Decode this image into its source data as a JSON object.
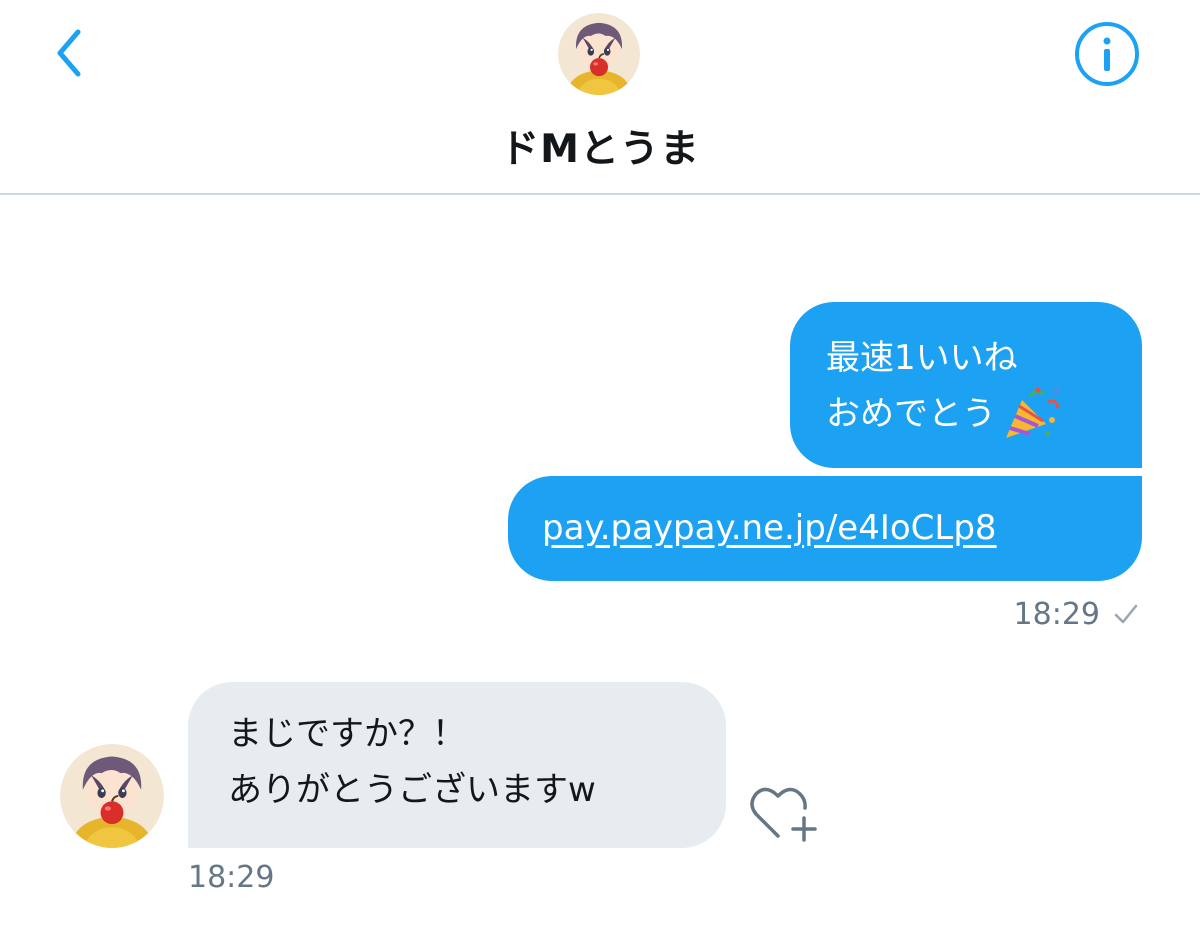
{
  "header": {
    "contact_name": "ドMとうま",
    "back_icon": "chevron-left-icon",
    "info_icon": "info-icon",
    "accent_color": "#1da1f2"
  },
  "messages": {
    "sent": [
      {
        "lines": [
          "最速1いいね",
          "おめでとう"
        ],
        "emoji": "party-popper-icon"
      },
      {
        "link_text": "pay.paypay.ne.jp/e4IoCLp8"
      }
    ],
    "sent_time": "18:29",
    "sent_status_icon": "check-icon",
    "received": {
      "lines": [
        "まじですか？！",
        "ありがとうございますw"
      ],
      "time": "18:29",
      "reaction_icon": "heart-plus-icon"
    }
  },
  "colors": {
    "sent_bubble": "#1da1f2",
    "received_bubble": "#e6ecf0",
    "meta_text": "#657786"
  }
}
